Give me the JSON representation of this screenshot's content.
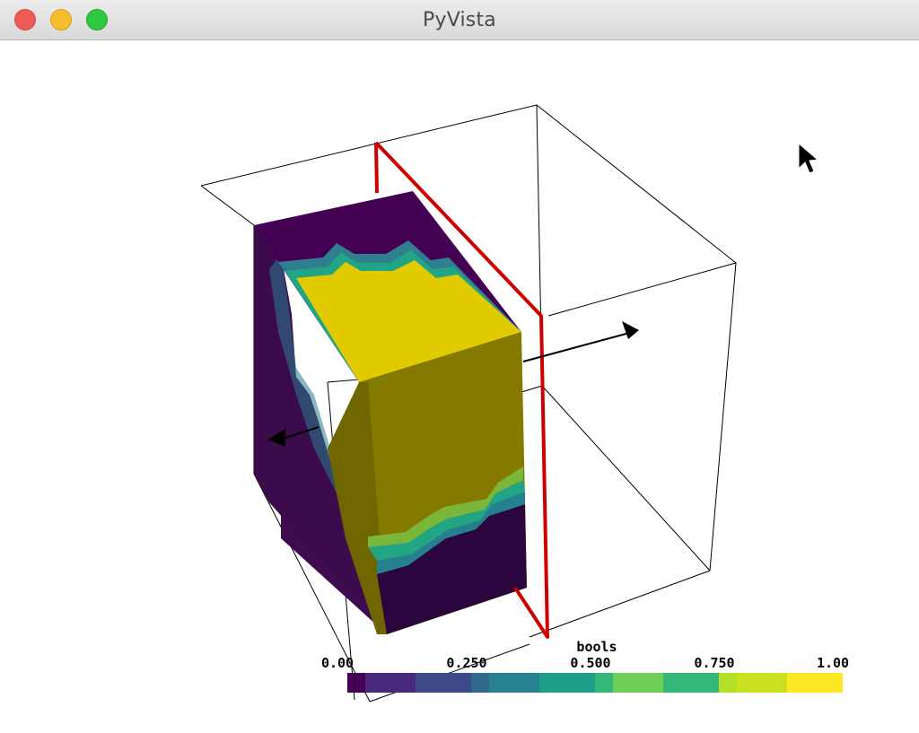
{
  "window": {
    "title": "PyVista",
    "controls": [
      "close-icon",
      "minimize-icon",
      "maximize-icon"
    ]
  },
  "scene": {
    "colormap": "viridis",
    "colors": {
      "background": "#ffffff",
      "bounds_outline": "#000000",
      "plane_widget": "#cc0000",
      "mesh_low": "#440154",
      "mesh_high": "#fde725"
    }
  },
  "scalar_bar": {
    "title": "bools",
    "tick_labels": [
      "0.00",
      "0.250",
      "0.500",
      "0.750",
      "1.00"
    ],
    "range": [
      0,
      1
    ]
  },
  "cursor": {
    "icon": "arrow-cursor-icon"
  }
}
